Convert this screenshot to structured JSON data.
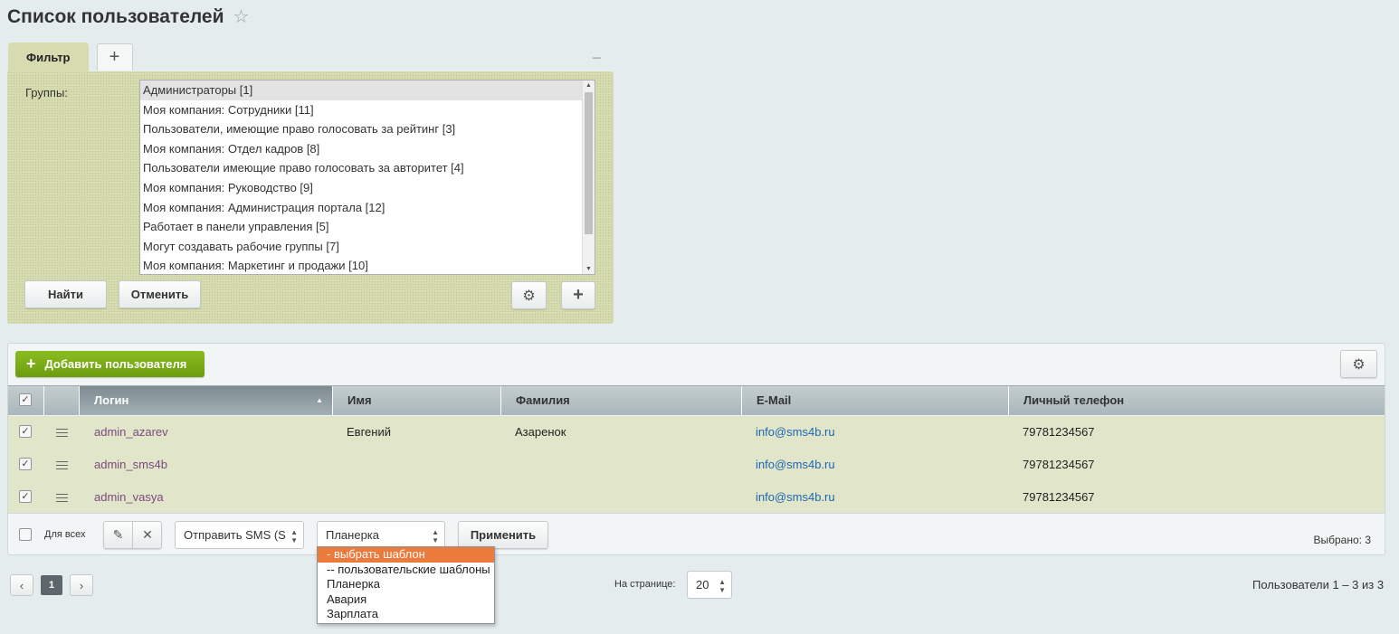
{
  "page": {
    "title": "Список пользователей"
  },
  "filter": {
    "tab_label": "Фильтр",
    "add_tab": "+",
    "collapse": "−",
    "groups_label": "Группы:",
    "groups": [
      "Администраторы [1]",
      "Моя компания: Сотрудники [11]",
      "Пользователи, имеющие право голосовать за рейтинг [3]",
      "Моя компания: Отдел кадров [8]",
      "Пользователи имеющие право голосовать за авторитет [4]",
      "Моя компания: Руководство [9]",
      "Моя компания: Администрация портала [12]",
      "Работает в панели управления [5]",
      "Могут создавать рабочие группы [7]",
      "Моя компания: Маркетинг и продажи [10]"
    ],
    "find_label": "Найти",
    "cancel_label": "Отменить"
  },
  "list": {
    "add_user_label": "Добавить пользователя",
    "columns": [
      "Логин",
      "Имя",
      "Фамилия",
      "E-Mail",
      "Личный телефон"
    ],
    "rows": [
      {
        "login": "admin_azarev",
        "first_name": "Евгений",
        "last_name": "Азаренок",
        "email": "info@sms4b.ru",
        "phone": "79781234567"
      },
      {
        "login": "admin_sms4b",
        "first_name": "",
        "last_name": "",
        "email": "info@sms4b.ru",
        "phone": "79781234567"
      },
      {
        "login": "admin_vasya",
        "first_name": "",
        "last_name": "",
        "email": "info@sms4b.ru",
        "phone": "79781234567"
      }
    ]
  },
  "actions": {
    "for_all_label": "Для всех",
    "action_select": "Отправить SMS (S",
    "template_select": "Планерка",
    "apply_label": "Применить",
    "selected_text": "Выбрано: 3",
    "template_options": [
      "- выбрать шаблон",
      "-- пользовательские шаблоны",
      "Планерка",
      "Авария",
      "Зарплата"
    ],
    "highlighted_option": 0
  },
  "pagination": {
    "current_page": "1",
    "per_page_label": "На странице:",
    "per_page_value": "20",
    "summary": "Пользователи 1 – 3 из 3"
  },
  "colors": {
    "accent_green": "#7aab18",
    "row_bg": "#e1e6cb",
    "filter_bg": "#d7dcb0",
    "dropdown_highlight": "#ec7a3a",
    "link_login": "#7a4a7d",
    "link_email": "#2067b0"
  }
}
